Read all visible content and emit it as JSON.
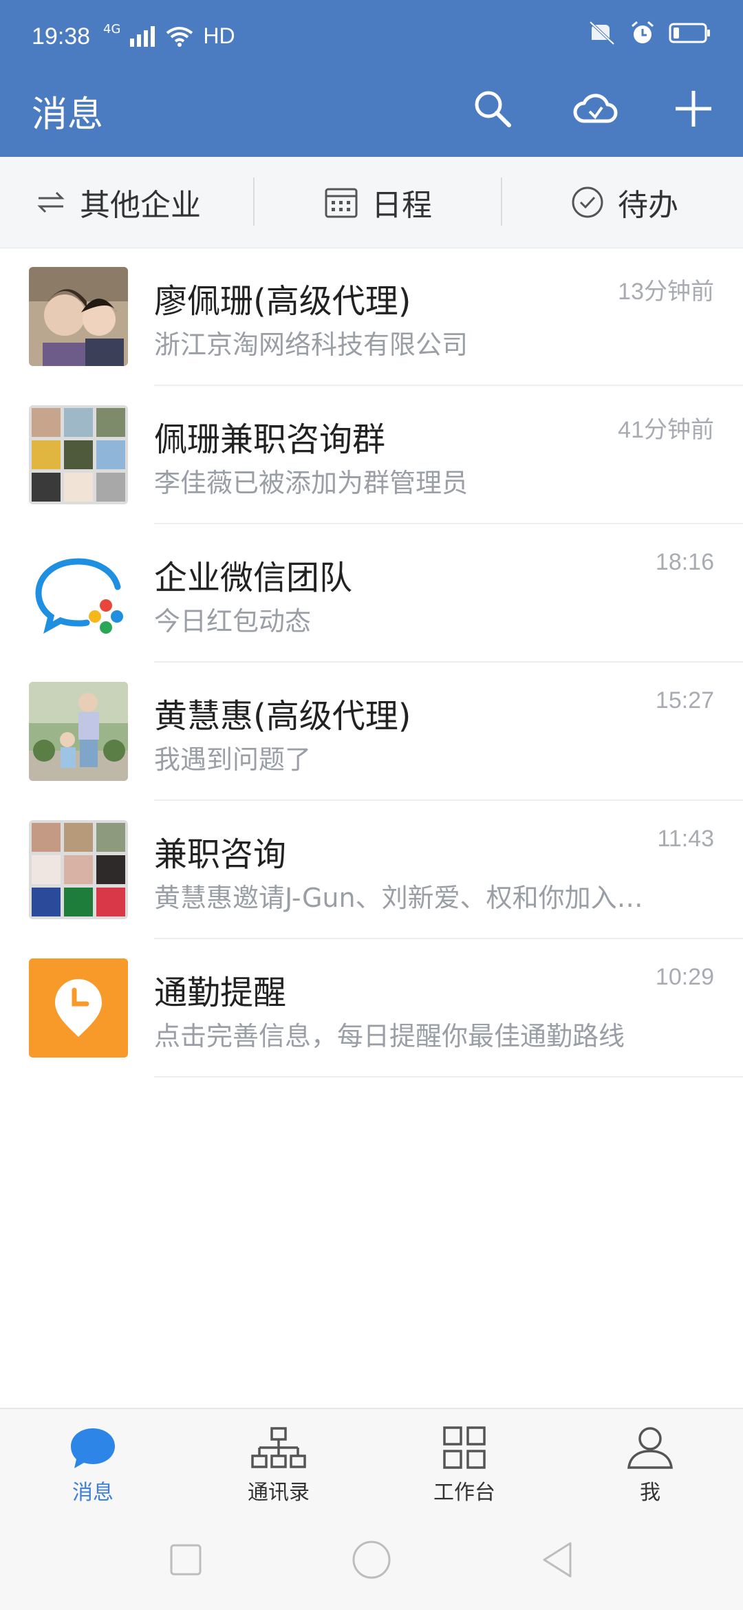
{
  "status": {
    "time": "19:38",
    "network": "4G",
    "hd": "HD"
  },
  "header": {
    "title": "消息",
    "icons": [
      "search-icon",
      "cloud-icon",
      "plus-icon"
    ]
  },
  "quickbar": {
    "items": [
      {
        "label": "其他企业",
        "icon": "switch-icon"
      },
      {
        "label": "日程",
        "icon": "calendar-icon"
      },
      {
        "label": "待办",
        "icon": "check-circle-icon"
      }
    ]
  },
  "chats": [
    {
      "name": "廖佩珊(高级代理)",
      "message": "浙江京淘网络科技有限公司",
      "time": "13分钟前",
      "avatar": "photo"
    },
    {
      "name": "佩珊兼职咨询群",
      "message": "李佳薇已被添加为群管理员",
      "time": "41分钟前",
      "avatar": "group-grid"
    },
    {
      "name": "企业微信团队",
      "message": "今日红包动态",
      "time": "18:16",
      "avatar": "wecom-logo"
    },
    {
      "name": "黄慧惠(高级代理)",
      "message": "我遇到问题了",
      "time": "15:27",
      "avatar": "photo"
    },
    {
      "name": "兼职咨询",
      "message": "黄慧惠邀请J-Gun、刘新爱、权和你加入…",
      "time": "11:43",
      "avatar": "group-grid"
    },
    {
      "name": "通勤提醒",
      "message": "点击完善信息，每日提醒你最佳通勤路线",
      "time": "10:29",
      "avatar": "commute-icon"
    }
  ],
  "bottom_nav": {
    "items": [
      {
        "label": "消息",
        "icon": "chat-bubble-icon",
        "active": true
      },
      {
        "label": "通讯录",
        "icon": "org-chart-icon",
        "active": false
      },
      {
        "label": "工作台",
        "icon": "grid-icon",
        "active": false
      },
      {
        "label": "我",
        "icon": "person-icon",
        "active": false
      }
    ]
  },
  "colors": {
    "header": "#4b7cc2",
    "accent": "#3d7fd9",
    "commute": "#f79a2a"
  }
}
